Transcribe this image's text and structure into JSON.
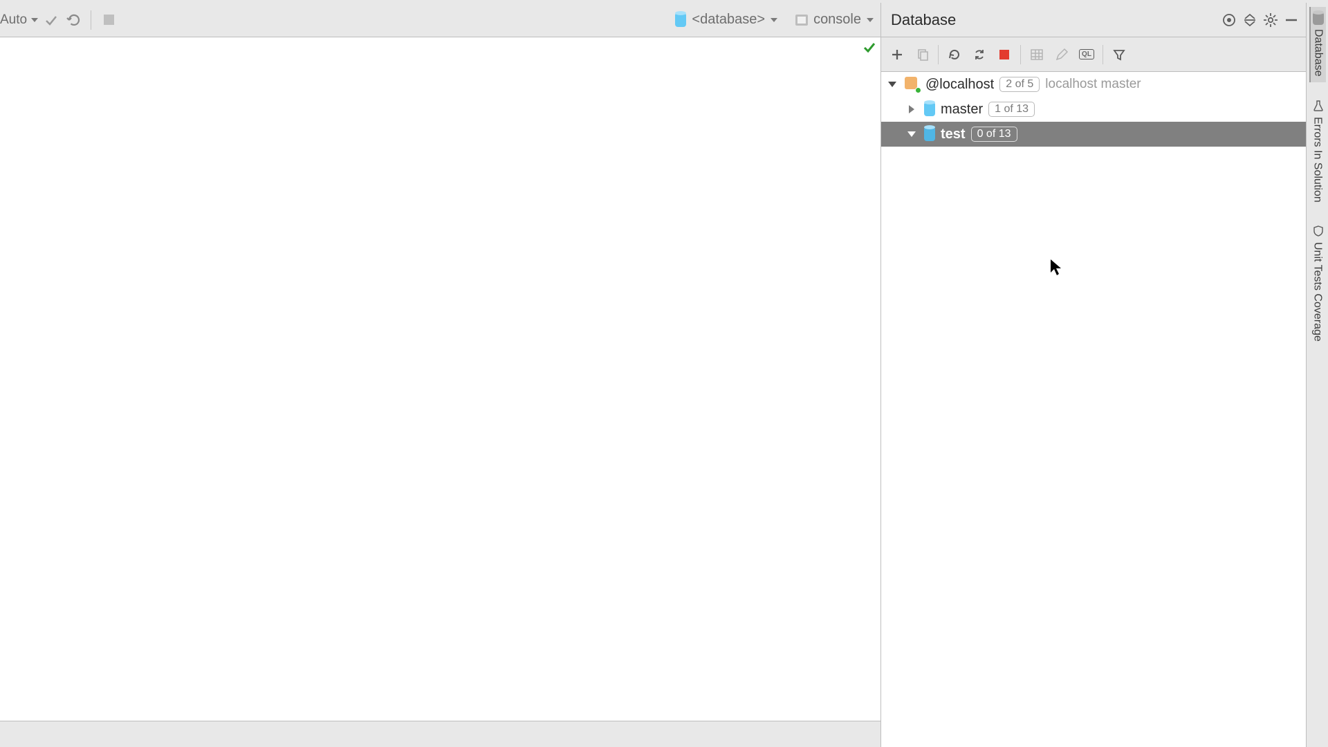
{
  "editor_toolbar": {
    "auto_label": "Auto",
    "database_dd": "<database>",
    "console_dd": "console"
  },
  "db_panel": {
    "title": "Database",
    "ql_label": "QL",
    "tree": {
      "connection": {
        "name": "@localhost",
        "badge": "2 of 5",
        "hint": "localhost master"
      },
      "children": [
        {
          "name": "master",
          "badge": "1 of 13",
          "expanded": false,
          "selected": false
        },
        {
          "name": "test",
          "badge": "0 of 13",
          "expanded": true,
          "selected": true
        }
      ]
    }
  },
  "right_rail": {
    "database": "Database",
    "errors": "Errors In Solution",
    "coverage": "Unit Tests Coverage"
  }
}
